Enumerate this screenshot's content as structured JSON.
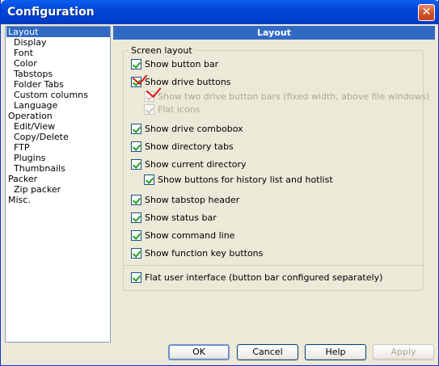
{
  "window": {
    "title": "Configuration"
  },
  "tree": [
    "Layout",
    "Display",
    "Font",
    "Color",
    "Tabstops",
    "Folder Tabs",
    "Custom columns",
    "Language",
    "Operation",
    "Edit/View",
    "Copy/Delete",
    "FTP",
    "Plugins",
    "Thumbnails",
    "Packer",
    "Zip packer",
    "Misc."
  ],
  "panel": {
    "header": "Layout",
    "group_title": "Screen layout",
    "options": [
      {
        "label": "Show button bar",
        "checked": true,
        "enabled": true
      },
      {
        "label": "Show drive buttons",
        "checked": true,
        "enabled": true
      },
      {
        "label": "Show two drive button bars (fixed width, above file windows)",
        "checked": true,
        "enabled": false
      },
      {
        "label": "Flat icons",
        "checked": true,
        "enabled": false
      },
      {
        "label": "Show drive combobox",
        "checked": true,
        "enabled": true
      },
      {
        "label": "Show directory tabs",
        "checked": true,
        "enabled": true
      },
      {
        "label": "Show current directory",
        "checked": true,
        "enabled": true
      },
      {
        "label": "Show buttons for history list and hotlist",
        "checked": true,
        "enabled": true
      },
      {
        "label": "Show tabstop header",
        "checked": true,
        "enabled": true
      },
      {
        "label": "Show status bar",
        "checked": true,
        "enabled": true
      },
      {
        "label": "Show command line",
        "checked": true,
        "enabled": true
      },
      {
        "label": "Show function key buttons",
        "checked": true,
        "enabled": true
      },
      {
        "label": "Flat user interface (button bar configured separately)",
        "checked": true,
        "enabled": true
      }
    ]
  },
  "buttons": {
    "ok": "OK",
    "cancel": "Cancel",
    "help": "Help",
    "apply": "Apply"
  }
}
